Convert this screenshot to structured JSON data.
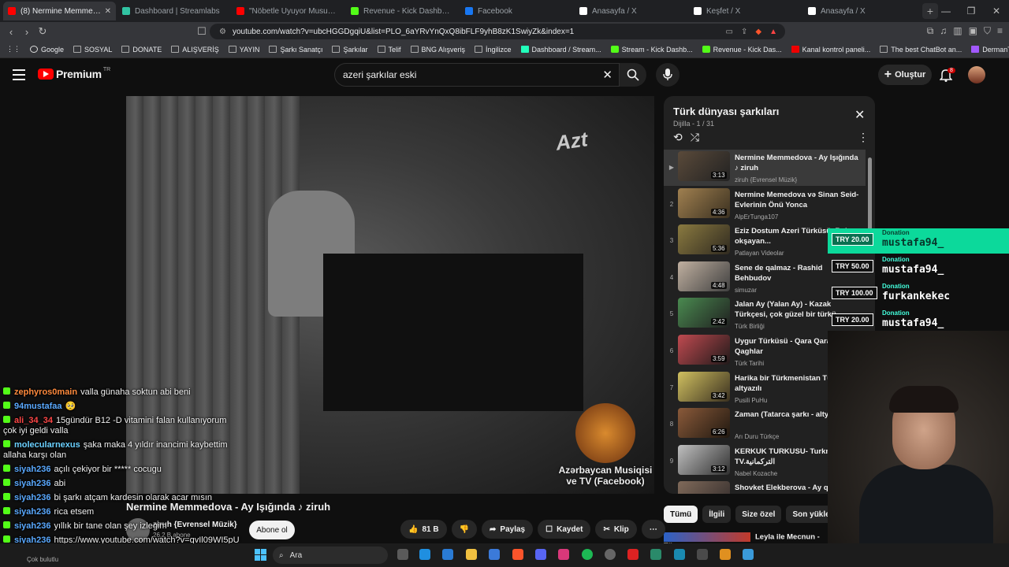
{
  "browser": {
    "tabs": [
      {
        "title": "(8) Nermine Memmedova",
        "active": true,
        "color": "#ff0000"
      },
      {
        "title": "Dashboard | Streamlabs",
        "active": false,
        "color": "#31c3a2"
      },
      {
        "title": "\"Nöbetle Uyuyor Musun ?\" - Y",
        "active": false,
        "color": "#ff0000"
      },
      {
        "title": "Revenue - Kick Dashboard",
        "active": false,
        "color": "#53fc18"
      },
      {
        "title": "Facebook",
        "active": false,
        "color": "#1877f2"
      },
      {
        "title": "Anasayfa / X",
        "active": false,
        "color": "#ffffff"
      },
      {
        "title": "Keşfet / X",
        "active": false,
        "color": "#ffffff"
      },
      {
        "title": "Anasayfa / X",
        "active": false,
        "color": "#ffffff"
      }
    ],
    "url": "youtube.com/watch?v=ubcHGGDgqiU&list=PLO_6aYRvYnQxQ8ibFLF9yhB8zK1SwiyZk&index=1",
    "bookmarks": [
      {
        "label": "Google",
        "icon": "g"
      },
      {
        "label": "SOSYAL",
        "icon": ""
      },
      {
        "label": "DONATE",
        "icon": ""
      },
      {
        "label": "ALIŞVERİŞ",
        "icon": ""
      },
      {
        "label": "YAYIN",
        "icon": ""
      },
      {
        "label": "Şarkı Sanatçı",
        "icon": ""
      },
      {
        "label": "Şarkılar",
        "icon": ""
      },
      {
        "label": "Telif",
        "icon": ""
      },
      {
        "label": "BNG Alışveriş",
        "icon": ""
      },
      {
        "label": "İngilizce",
        "icon": ""
      },
      {
        "label": "Dashboard / Stream...",
        "icon": "s"
      },
      {
        "label": "Stream - Kick Dashb...",
        "icon": "k"
      },
      {
        "label": "Revenue - Kick Das...",
        "icon": "k"
      },
      {
        "label": "Kanal kontrol paneli...",
        "icon": "r"
      },
      {
        "label": "The best ChatBot an...",
        "icon": ""
      },
      {
        "label": "DermanTarcin - Vid...",
        "icon": "p"
      }
    ]
  },
  "youtube": {
    "logo": "Premium",
    "country": "TR",
    "search_value": "azeri şarkılar eski",
    "create_label": "Oluştur",
    "notif_count": "8",
    "video": {
      "logo_text": "Azt",
      "watermark": "Azərbaycan Musiqisi ve TV (Facebook)",
      "title": "Nermine Memmedova - Ay Işığında ♪ ziruh",
      "channel": "ziruh {Evrensel Müzik}",
      "subscribers": "26,2 B abone",
      "subscribe_label": "Abone ol",
      "likes": "81 B",
      "share_label": "Paylaş",
      "save_label": "Kaydet",
      "clip_label": "Klip"
    },
    "playlist": {
      "title": "Türk dünyası şarkıları",
      "subtitle": "Dijilla - 1 / 31",
      "items": [
        {
          "idx": "▶",
          "title": "Nermine Memmedova - Ay Işığında ♪ ziruh",
          "channel": "ziruh {Evrensel Müzik}",
          "duration": "3:13"
        },
        {
          "idx": "2",
          "title": "Nermine Memedova və Sinan Seid- Evlerinin Önü Yonca",
          "channel": "AlpErTunga107",
          "duration": "4:36"
        },
        {
          "idx": "3",
          "title": "Eziz Dostum Azeri Türküsü..Ruhu okşayan...",
          "channel": "Patlayan Videolar",
          "duration": "5:36"
        },
        {
          "idx": "4",
          "title": "Sene de qalmaz - Rashid Behbudov",
          "channel": "simuzar",
          "duration": "4:48"
        },
        {
          "idx": "5",
          "title": "Jalan Ay (Yalan Ay) - Kazak Türkçesi, çok güzel bir türkü",
          "channel": "Türk Birliği",
          "duration": "2:42"
        },
        {
          "idx": "6",
          "title": "Uygur Türküsü - Qara Qara Qaghlar",
          "channel": "Türk Tarihi",
          "duration": "3:59"
        },
        {
          "idx": "7",
          "title": "Harika bir Türkmenistan Türküsü altyazılı",
          "channel": "Pusili PuHu",
          "duration": "3:42"
        },
        {
          "idx": "8",
          "title": "Zaman (Tatarca şarkı - altyazılı)",
          "channel": "Arı Duru Türkçe",
          "duration": "6:26"
        },
        {
          "idx": "9",
          "title": "KERKUK TURKUSU- Turkmen TV.التركمانية",
          "channel": "Nabel Kozache",
          "duration": "3:12"
        },
        {
          "idx": "10",
          "title": "Shovket Elekberova - Ay qiz",
          "channel": "",
          "duration": ""
        }
      ]
    },
    "chips": [
      "Tümü",
      "İlgili",
      "Size özel",
      "Son yüklenen"
    ],
    "next_title": "Leyla ile Mecnun - Tü"
  },
  "overlay": {
    "chat": [
      {
        "user": "zephyros0main",
        "color": "#ff8a3d",
        "msg": "valla günaha soktun abi beni"
      },
      {
        "user": "94mustafaa",
        "color": "#5aa9ff",
        "msg": "🥺"
      },
      {
        "user": "ali_34_34",
        "color": "#ff4747",
        "msg": "15gündür B12 -D vitamini falan kullanıyorum çok iyi geldi valla"
      },
      {
        "user": "molecularnexus",
        "color": "#6bd0ff",
        "msg": "şaka maka 4 yıldır inancimi kaybettim allaha karşı olan"
      },
      {
        "user": "siyah236",
        "color": "#5aa9ff",
        "msg": "açılı çekiyor bir ***** cocugu"
      },
      {
        "user": "siyah236",
        "color": "#5aa9ff",
        "msg": "abi"
      },
      {
        "user": "siyah236",
        "color": "#5aa9ff",
        "msg": "bi şarkı atçam kardesin olarak acar mısın"
      },
      {
        "user": "siyah236",
        "color": "#5aa9ff",
        "msg": "rica etsem"
      },
      {
        "user": "siyah236",
        "color": "#5aa9ff",
        "msg": "yıllık bir tane olan şey izlegim"
      },
      {
        "user": "siyah236",
        "color": "#5aa9ff",
        "msg": "https://www.youtube.com/watch?v=qvIl09WI5pU"
      }
    ],
    "donations": [
      {
        "amount": "TRY 20.00",
        "label": "Donation",
        "name": "mustafa94_",
        "highlight": true
      },
      {
        "amount": "TRY 50.00",
        "label": "Donation",
        "name": "mustafa94_",
        "highlight": false
      },
      {
        "amount": "TRY 100.00",
        "label": "Donation",
        "name": "furkankekec",
        "highlight": false
      },
      {
        "amount": "TRY 20.00",
        "label": "Donation",
        "name": "mustafa94_",
        "highlight": false
      }
    ]
  },
  "taskbar": {
    "search_label": "Ara",
    "weather_label": "Çok bulutlu"
  }
}
